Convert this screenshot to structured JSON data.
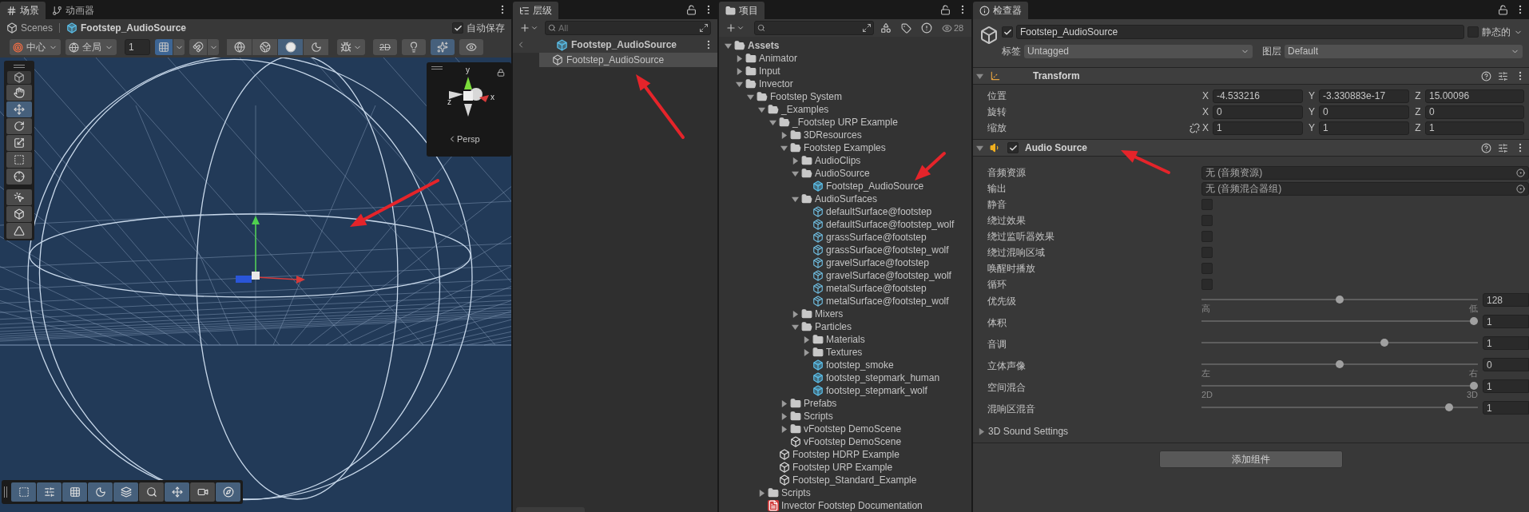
{
  "scene_view": {
    "tabs": [
      {
        "label": "场景",
        "kind": "scene",
        "selected": true
      },
      {
        "label": "动画器",
        "kind": "animator",
        "selected": false
      }
    ],
    "breadcrumb": [
      {
        "label": "Scenes",
        "kind": "scenes"
      },
      {
        "label": "Footstep_AudioSource",
        "kind": "prefab"
      }
    ],
    "autosave": {
      "label": "自动保存",
      "checked": true
    },
    "pivot": "中心",
    "space": "全局",
    "grid_size": "1",
    "snap_toggles": [
      {
        "kind": "grid-snap",
        "on": true
      },
      {
        "kind": "increment-snap",
        "on": false
      }
    ],
    "shading_modes": [
      {
        "kind": "wireframe",
        "selected": false
      },
      {
        "kind": "shaded-wireframe",
        "selected": false
      },
      {
        "kind": "shaded",
        "selected": true
      },
      {
        "kind": "unlit",
        "selected": false
      }
    ],
    "view_toggles": [
      {
        "kind": "flat",
        "label": "2D",
        "on": false
      },
      {
        "kind": "lighting",
        "on": false
      },
      {
        "kind": "effects",
        "on": true
      },
      {
        "kind": "visibility",
        "on": false
      }
    ],
    "tools": [
      {
        "kind": "hand",
        "selected": false
      },
      {
        "kind": "move",
        "selected": true
      },
      {
        "kind": "rotate",
        "selected": false
      },
      {
        "kind": "scale",
        "selected": false
      },
      {
        "kind": "rect",
        "selected": false
      },
      {
        "kind": "transform",
        "selected": false
      }
    ],
    "custom_tools": [
      {
        "kind": "custom",
        "selected": false
      },
      {
        "kind": "cube",
        "selected": false
      },
      {
        "kind": "navmesh",
        "selected": false
      }
    ],
    "gizmo": {
      "axes": [
        "y",
        "z",
        "x"
      ],
      "projection": "Persp"
    },
    "overlay_toggles": [
      {
        "kind": "rect",
        "on": true
      },
      {
        "kind": "sliders",
        "on": true
      },
      {
        "kind": "grid",
        "on": true
      },
      {
        "kind": "moon",
        "on": true
      },
      {
        "kind": "layers",
        "on": true
      },
      {
        "kind": "search",
        "on": false
      },
      {
        "kind": "move",
        "on": true
      },
      {
        "kind": "camera",
        "on": false
      },
      {
        "kind": "compass",
        "on": true
      }
    ]
  },
  "hierarchy": {
    "tab": "层级",
    "search_placeholder": "All",
    "root": "Footstep_AudioSource",
    "items": [
      {
        "label": "Footstep_AudioSource",
        "selected": true
      }
    ]
  },
  "project": {
    "tab": "项目",
    "hidden_count": "28",
    "tree": [
      {
        "label": "Assets",
        "kind": "folder",
        "expanded": true,
        "children": [
          {
            "label": "Animator",
            "kind": "folder",
            "expanded": false
          },
          {
            "label": "Input",
            "kind": "folder",
            "expanded": false
          },
          {
            "label": "Invector",
            "kind": "folder",
            "expanded": true,
            "children": [
              {
                "label": "Footstep System",
                "kind": "folder",
                "expanded": true,
                "children": [
                  {
                    "label": "_Examples",
                    "kind": "folder",
                    "expanded": true,
                    "children": [
                      {
                        "label": "_Footstep URP Example",
                        "kind": "folder",
                        "expanded": true,
                        "children": [
                          {
                            "label": "3DResources",
                            "kind": "folder",
                            "expanded": false
                          },
                          {
                            "label": "Footstep Examples",
                            "kind": "folder",
                            "expanded": true,
                            "children": [
                              {
                                "label": "AudioClips",
                                "kind": "folder",
                                "expanded": false
                              },
                              {
                                "label": "AudioSource",
                                "kind": "folder",
                                "expanded": true,
                                "children": [
                                  {
                                    "label": "Footstep_AudioSource",
                                    "kind": "prefab"
                                  }
                                ]
                              },
                              {
                                "label": "AudioSurfaces",
                                "kind": "folder",
                                "expanded": true,
                                "children": [
                                  {
                                    "label": "defaultSurface@footstep",
                                    "kind": "asset"
                                  },
                                  {
                                    "label": "defaultSurface@footstep_wolf",
                                    "kind": "asset"
                                  },
                                  {
                                    "label": "grassSurface@footstep",
                                    "kind": "asset"
                                  },
                                  {
                                    "label": "grassSurface@footstep_wolf",
                                    "kind": "asset"
                                  },
                                  {
                                    "label": "gravelSurface@footstep",
                                    "kind": "asset"
                                  },
                                  {
                                    "label": "gravelSurface@footstep_wolf",
                                    "kind": "asset"
                                  },
                                  {
                                    "label": "metalSurface@footstep",
                                    "kind": "asset"
                                  },
                                  {
                                    "label": "metalSurface@footstep_wolf",
                                    "kind": "asset"
                                  }
                                ]
                              },
                              {
                                "label": "Mixers",
                                "kind": "folder",
                                "expanded": false
                              },
                              {
                                "label": "Particles",
                                "kind": "folder",
                                "expanded": true,
                                "children": [
                                  {
                                    "label": "Materials",
                                    "kind": "folder",
                                    "expanded": false
                                  },
                                  {
                                    "label": "Textures",
                                    "kind": "folder",
                                    "expanded": false
                                  },
                                  {
                                    "label": "footstep_smoke",
                                    "kind": "prefab"
                                  },
                                  {
                                    "label": "footstep_stepmark_human",
                                    "kind": "prefab"
                                  },
                                  {
                                    "label": "footstep_stepmark_wolf",
                                    "kind": "prefab"
                                  }
                                ]
                              }
                            ]
                          },
                          {
                            "label": "Prefabs",
                            "kind": "folder",
                            "expanded": false
                          },
                          {
                            "label": "Scripts",
                            "kind": "folder",
                            "expanded": false
                          },
                          {
                            "label": "vFootstep DemoScene",
                            "kind": "folder",
                            "expanded": false
                          },
                          {
                            "label": "vFootstep DemoScene",
                            "kind": "scene"
                          }
                        ]
                      },
                      {
                        "label": "Footstep HDRP Example",
                        "kind": "scene"
                      },
                      {
                        "label": "Footstep URP Example",
                        "kind": "scene"
                      },
                      {
                        "label": "Footstep_Standard_Example",
                        "kind": "scene"
                      }
                    ]
                  },
                  {
                    "label": "Scripts",
                    "kind": "folder",
                    "expanded": false
                  },
                  {
                    "label": "Invector Footstep Documentation",
                    "kind": "document"
                  }
                ]
              }
            ]
          }
        ]
      }
    ]
  },
  "inspector": {
    "tab": "检查器",
    "object": {
      "name": "Footstep_AudioSource",
      "active": true,
      "static_label": "静态的",
      "static": false,
      "tag_label": "标签",
      "tag": "Untagged",
      "layer_label": "图层",
      "layer": "Default"
    },
    "components": [
      {
        "kind": "transform",
        "title": "Transform",
        "expanded": true,
        "rows": [
          {
            "label": "位置",
            "axes": [
              "X",
              "Y",
              "Z"
            ],
            "values": [
              "-4.533216",
              "-3.330883e-17",
              "15.00096"
            ]
          },
          {
            "label": "旋转",
            "axes": [
              "X",
              "Y",
              "Z"
            ],
            "values": [
              "0",
              "0",
              "0"
            ]
          },
          {
            "label": "缩放",
            "linked": false,
            "axes": [
              "X",
              "Y",
              "Z"
            ],
            "values": [
              "1",
              "1",
              "1"
            ]
          }
        ]
      },
      {
        "kind": "audio",
        "title": "Audio Source",
        "expanded": true,
        "enabled": true,
        "properties": [
          {
            "kind": "object",
            "label": "音频资源",
            "value": "无 (音频资源)"
          },
          {
            "kind": "object",
            "label": "输出",
            "value": "无 (音频混合器组)"
          },
          {
            "kind": "checkbox",
            "label": "静音",
            "checked": false
          },
          {
            "kind": "checkbox",
            "label": "绕过效果",
            "checked": false
          },
          {
            "kind": "checkbox",
            "label": "绕过监听器效果",
            "checked": false
          },
          {
            "kind": "checkbox",
            "label": "绕过混响区域",
            "checked": false
          },
          {
            "kind": "checkbox",
            "label": "唤醒时播放",
            "checked": false
          },
          {
            "kind": "checkbox",
            "label": "循环",
            "checked": false
          },
          {
            "kind": "slider",
            "label": "优先级",
            "level": 0.5,
            "value": "128",
            "min_label": "高",
            "max_label": "低"
          },
          {
            "kind": "slider",
            "label": "体积",
            "level": 1,
            "value": "1"
          },
          {
            "kind": "slider",
            "label": "音调",
            "level": 0.667,
            "value": "1"
          },
          {
            "kind": "slider",
            "label": "立体声像",
            "level": 0.5,
            "value": "0",
            "min_label": "左",
            "max_label": "右"
          },
          {
            "kind": "slider",
            "label": "空间混合",
            "level": 1,
            "value": "1",
            "min_label": "2D",
            "max_label": "3D"
          },
          {
            "kind": "slider",
            "label": "混响区混音",
            "level": 0.909,
            "value": "1"
          }
        ],
        "foldouts": [
          {
            "label": "3D Sound Settings",
            "expanded": false
          }
        ]
      }
    ],
    "add_button": "添加组件"
  }
}
